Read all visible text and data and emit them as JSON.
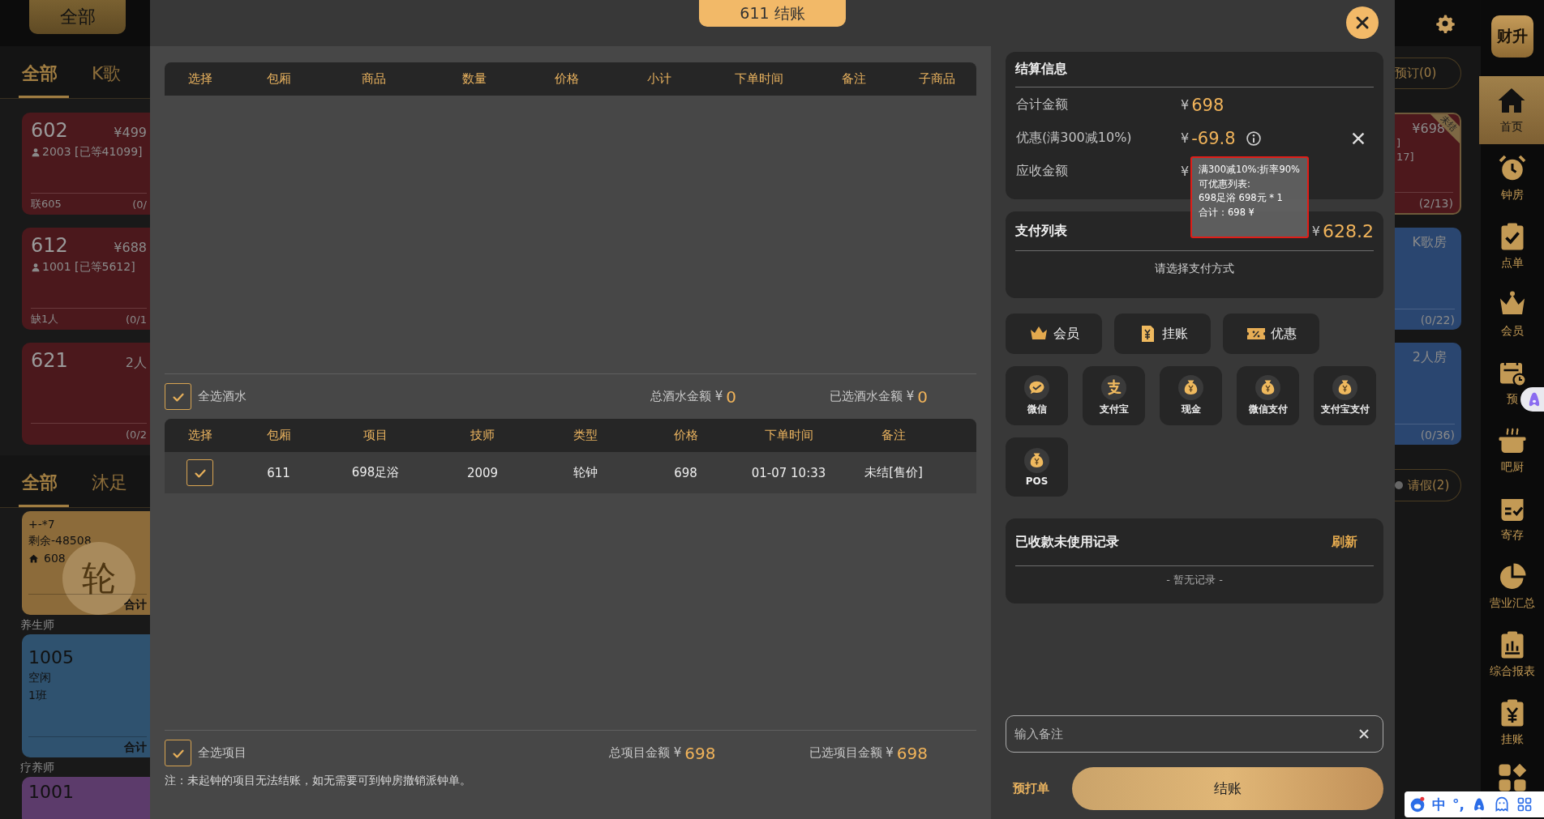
{
  "left_background": {
    "top_button": "全部",
    "room_tabs": [
      {
        "label": "全部",
        "selected": true
      },
      {
        "label": "K歌",
        "selected": false
      }
    ],
    "room_cards": [
      {
        "room": "602",
        "price": "¥499",
        "guest": "2003 [已等41099]",
        "footer_left": "联605",
        "footer_right": "(0/"
      },
      {
        "room": "612",
        "price": "¥688",
        "guest": "1001 [已等5612]",
        "footer_left": "缺1人",
        "footer_right": "(0/1"
      },
      {
        "room": "621",
        "price": "2人",
        "footer_right": "(0/2"
      }
    ],
    "staff_tabs": [
      {
        "label": "全部",
        "selected": true
      },
      {
        "label": "沐足",
        "selected": false
      }
    ],
    "staff_list": [
      {
        "kind": "card",
        "color": "#8c6b3a",
        "lines": [
          "+-*7",
          "剩余-48508"
        ],
        "room": "608",
        "badge": "轮",
        "footer": "合计"
      },
      {
        "kind": "heading",
        "text": "养生师"
      },
      {
        "kind": "card",
        "color": "#2f526f",
        "title": "1005",
        "lines": [
          "空闲",
          "1班"
        ],
        "footer": "合计"
      },
      {
        "kind": "heading",
        "text": "疗养师"
      },
      {
        "kind": "card",
        "color": "#5c3b6b",
        "title": "1001"
      }
    ]
  },
  "right_background": {
    "reserve_button": "预订(0)",
    "room_cards": [
      {
        "color": "#4d181c",
        "label": "¥698",
        "ribbon": "未结",
        "lines": [
          "]",
          "17]"
        ],
        "footer": "(2/13)"
      },
      {
        "color": "#2a4670",
        "label": "K歌房",
        "footer": "(0/22)"
      },
      {
        "color": "#2a4670",
        "label": "2人房",
        "footer": "(0/36)"
      }
    ],
    "leave_button": "请假(2)"
  },
  "sidebar": {
    "logo": "财升",
    "items": [
      {
        "label": "首页",
        "selected": true
      },
      {
        "label": "钟房",
        "selected": false
      },
      {
        "label": "点单",
        "selected": false
      },
      {
        "label": "会员",
        "selected": false
      },
      {
        "label": "预",
        "selected": false
      },
      {
        "label": "吧厨",
        "selected": false
      },
      {
        "label": "寄存",
        "selected": false
      },
      {
        "label": "营业汇总",
        "selected": false
      },
      {
        "label": "综合报表",
        "selected": false
      },
      {
        "label": "挂账",
        "selected": false
      }
    ]
  },
  "ime_toolbar": {
    "language": "中",
    "punctuation": "°,"
  },
  "dialog": {
    "title": "611 结账",
    "products": {
      "select_column": "选择",
      "columns": [
        "包厢",
        "商品",
        "数量",
        "价格",
        "小计",
        "下单时间",
        "备注",
        "子商品"
      ],
      "select_all": {
        "label": "全选酒水",
        "checked": true
      },
      "total_label": "总酒水金额 ¥",
      "total": "0",
      "selected_label": "已选酒水金额 ¥",
      "selected_total": "0"
    },
    "projects": {
      "select_column": "选择",
      "columns": [
        "包厢",
        "项目",
        "技师",
        "类型",
        "价格",
        "下单时间",
        "备注"
      ],
      "rows": [
        {
          "selected": true,
          "cells": [
            "611",
            "698足浴",
            "2009",
            "轮钟",
            "698",
            "01-07 10:33",
            "未结[售价]"
          ]
        }
      ],
      "select_all": {
        "label": "全选项目",
        "checked": true
      },
      "total_label": "总项目金额 ¥",
      "total": "698",
      "selected_label": "已选项目金额 ¥",
      "selected_total": "698"
    },
    "note": "注：未起钟的项目无法结账，如无需要可到钟房撤销派钟单。",
    "settlement": {
      "title": "结算信息",
      "rows": [
        {
          "label": "合计金额",
          "currency": "¥",
          "value": "698",
          "info": false,
          "removable": false
        },
        {
          "label": "优惠(满300减10%)",
          "currency": "¥",
          "value": "-69.8",
          "info": true,
          "removable": true
        },
        {
          "label": "应收金额",
          "currency": "¥",
          "info": false,
          "removable": false
        }
      ],
      "tooltip": [
        "满300减10%:折率90%",
        "可优惠列表:",
        "698足浴 698元 * 1",
        "合计：698 ¥"
      ]
    },
    "payments": {
      "title": "支付列表",
      "currency": "¥",
      "diff": "628.2",
      "empty": "请选择支付方式"
    },
    "actions": [
      "会员",
      "挂账",
      "优惠"
    ],
    "methods": [
      "微信",
      "支付宝",
      "现金",
      "微信支付",
      "支付宝支付",
      "POS"
    ],
    "records": {
      "title": "已收款未使用记录",
      "refresh": "刷新",
      "empty": "- 暂无记录 -"
    },
    "remark": {
      "placeholder": "输入备注"
    },
    "preprint": "预打单",
    "checkout": "结账"
  }
}
